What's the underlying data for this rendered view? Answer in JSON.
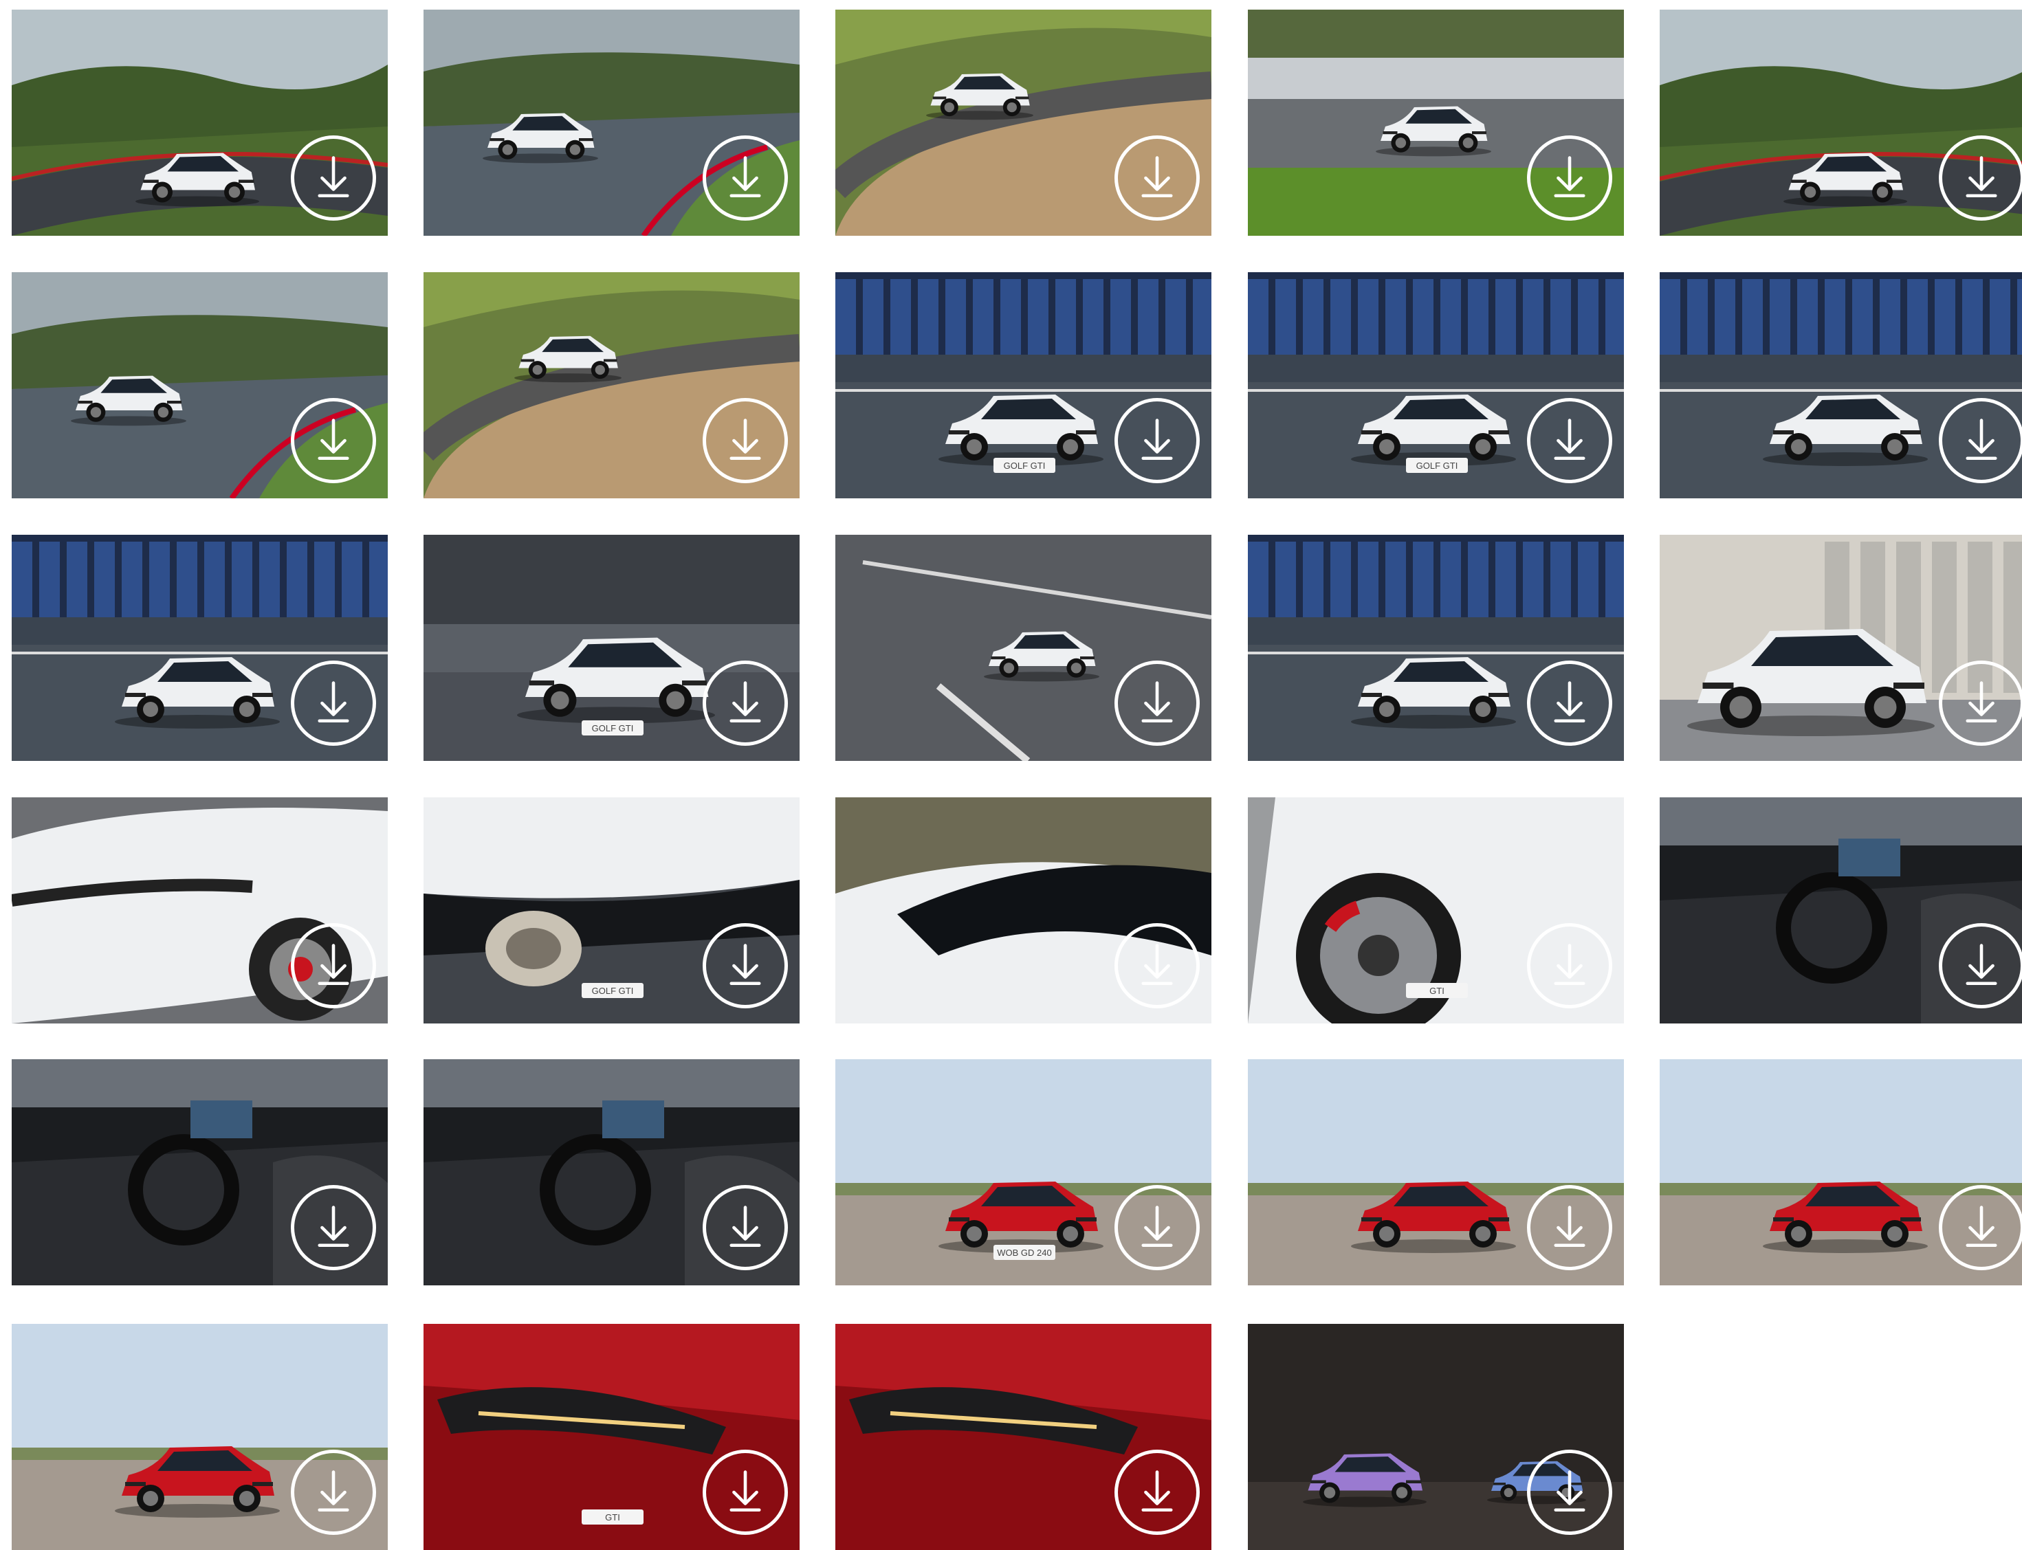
{
  "gallery": {
    "download_icon": "download-icon",
    "colors": {
      "button_ring": "#ffffff",
      "car_white": "#eef0f2",
      "car_red": "#c8141e"
    },
    "items": [
      {
        "scene": "track-green",
        "car": "white",
        "plate": "",
        "alt": "White car on forest track"
      },
      {
        "scene": "track-wet",
        "car": "white",
        "plate": "",
        "alt": "White car rear view on wet track"
      },
      {
        "scene": "track-sand",
        "car": "white",
        "plate": "",
        "alt": "White car cornering"
      },
      {
        "scene": "track-motion",
        "car": "white",
        "plate": "",
        "alt": "White car at speed"
      },
      {
        "scene": "track-green",
        "car": "white",
        "plate": "",
        "alt": "White car front on track"
      },
      {
        "scene": "track-wet",
        "car": "white",
        "plate": "",
        "alt": "White car rear on damp road"
      },
      {
        "scene": "track-sand",
        "car": "white",
        "plate": "",
        "alt": "White car from above"
      },
      {
        "scene": "stadium",
        "car": "white",
        "plate": "GOLF GTI",
        "alt": "White car front in stadium"
      },
      {
        "scene": "stadium",
        "car": "white",
        "plate": "GOLF GTI",
        "alt": "White car rear in stadium"
      },
      {
        "scene": "stadium",
        "car": "white",
        "plate": "",
        "alt": "White car side in stadium"
      },
      {
        "scene": "stadium",
        "car": "white",
        "plate": "",
        "alt": "White car side at pit lane"
      },
      {
        "scene": "pit",
        "car": "white",
        "plate": "GOLF GTI",
        "alt": "White car rear close"
      },
      {
        "scene": "asphalt",
        "car": "white",
        "plate": "",
        "alt": "White car top view on asphalt"
      },
      {
        "scene": "stadium",
        "car": "white",
        "plate": "",
        "alt": "White car on grid"
      },
      {
        "scene": "garage",
        "car": "white",
        "plate": "",
        "alt": "White car detail by garages"
      },
      {
        "scene": "detail-white",
        "car": "white",
        "plate": "",
        "alt": "Front detail"
      },
      {
        "scene": "detail-exhaust",
        "car": "white",
        "plate": "GOLF GTI",
        "alt": "Exhaust detail"
      },
      {
        "scene": "detail-roof",
        "car": "white",
        "plate": "",
        "alt": "Rear spoiler detail"
      },
      {
        "scene": "detail-wheel",
        "car": "white",
        "plate": "GTI",
        "alt": "Wheel and badge detail"
      },
      {
        "scene": "interior",
        "car": "white",
        "plate": "",
        "alt": "Seats interior"
      },
      {
        "scene": "interior",
        "car": "red",
        "plate": "",
        "alt": "Cockpit interior"
      },
      {
        "scene": "interior",
        "car": "red",
        "plate": "",
        "alt": "Steering wheel interior"
      },
      {
        "scene": "airfield",
        "car": "red",
        "plate": "WOB GD 240",
        "alt": "Red car front"
      },
      {
        "scene": "airfield",
        "car": "red",
        "plate": "",
        "alt": "Red car side"
      },
      {
        "scene": "airfield",
        "car": "red",
        "plate": "",
        "alt": "Red car rear three-quarter"
      },
      {
        "scene": "airfield",
        "car": "red",
        "plate": "",
        "alt": "Red car front three-quarter"
      },
      {
        "scene": "detail-red",
        "car": "red",
        "plate": "GTI",
        "alt": "Headlight detail"
      },
      {
        "scene": "detail-red",
        "car": "red",
        "plate": "",
        "alt": "Taillight detail"
      },
      {
        "scene": "studio-art",
        "car": "art",
        "plate": "",
        "alt": "Two art cars in studio"
      }
    ]
  }
}
